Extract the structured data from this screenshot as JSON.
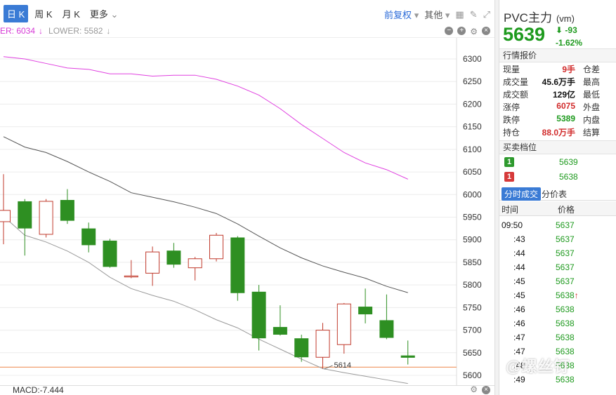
{
  "toolbar": {
    "periods": [
      "日 K",
      "周 K",
      "月 K",
      "更多"
    ],
    "more_arrow": "⌄",
    "fuquan": "前复权",
    "other": "其他",
    "caret": "▾"
  },
  "indicator": {
    "upper": "ER: 6034",
    "upper_arrow": "↓",
    "lower": "LOWER: 5582",
    "lower_arrow": "↓"
  },
  "macd": {
    "label": "MACD:-7.444"
  },
  "quote": {
    "symbol": "PVC主力",
    "code": "(vm)",
    "price": "5639",
    "change": "-93",
    "change_arrow": "⬇",
    "change_pct": "-1.62%"
  },
  "sections": {
    "quote_title": "行情报价",
    "orderbook_title": "买卖档位"
  },
  "quote_rows": [
    {
      "k": "现量",
      "v": "9手",
      "color": "#d12b2b",
      "k2": "仓差"
    },
    {
      "k": "成交量",
      "v": "45.6万手",
      "color": "#111111",
      "k2": "最高"
    },
    {
      "k": "成交额",
      "v": "129亿",
      "color": "#111111",
      "k2": "最低"
    },
    {
      "k": "涨停",
      "v": "6075",
      "color": "#d12b2b",
      "k2": "外盘"
    },
    {
      "k": "跌停",
      "v": "5389",
      "color": "#1e9a1e",
      "k2": "内盘"
    },
    {
      "k": "持仓",
      "v": "88.0万手",
      "color": "#d12b2b",
      "k2": "结算"
    }
  ],
  "orderbook": [
    {
      "badge": "1",
      "side": "g",
      "price": "5639"
    },
    {
      "badge": "1",
      "side": "r",
      "price": "5638"
    }
  ],
  "tabs": {
    "active": "分时成交",
    "other": "分价表"
  },
  "ticks_header": {
    "time": "时间",
    "price": "价格"
  },
  "ticks": [
    {
      "t": "09:50",
      "p": "5637"
    },
    {
      "t": ":43",
      "p": "5637"
    },
    {
      "t": ":44",
      "p": "5637"
    },
    {
      "t": ":44",
      "p": "5637"
    },
    {
      "t": ":45",
      "p": "5637"
    },
    {
      "t": ":45",
      "p": "5638",
      "up": "↑"
    },
    {
      "t": ":46",
      "p": "5638"
    },
    {
      "t": ":46",
      "p": "5638"
    },
    {
      "t": ":47",
      "p": "5638"
    },
    {
      "t": ":47",
      "p": "5638"
    },
    {
      "t": ":48",
      "p": "5638"
    },
    {
      "t": ":49",
      "p": "5638"
    }
  ],
  "watermark": "@螺丝钉",
  "chart_data": {
    "type": "candlestick",
    "y_ticks": [
      6300,
      6250,
      6200,
      6150,
      6100,
      6050,
      6000,
      5950,
      5900,
      5850,
      5800,
      5750,
      5700,
      5650,
      5600
    ],
    "ylim": [
      5590,
      6310
    ],
    "candles": [
      {
        "o": 5940,
        "c": 5965,
        "h": 6045,
        "l": 5890
      },
      {
        "o": 5985,
        "c": 5925,
        "h": 5990,
        "l": 5865
      },
      {
        "o": 5912,
        "c": 5985,
        "h": 5990,
        "l": 5905
      },
      {
        "o": 5988,
        "c": 5942,
        "h": 6012,
        "l": 5935
      },
      {
        "o": 5925,
        "c": 5888,
        "h": 5938,
        "l": 5872
      },
      {
        "o": 5898,
        "c": 5840,
        "h": 5902,
        "l": 5838
      },
      {
        "o": 5818,
        "c": 5820,
        "h": 5855,
        "l": 5815
      },
      {
        "o": 5826,
        "c": 5873,
        "h": 5885,
        "l": 5798
      },
      {
        "o": 5876,
        "c": 5845,
        "h": 5893,
        "l": 5838
      },
      {
        "o": 5838,
        "c": 5858,
        "h": 5862,
        "l": 5810
      },
      {
        "o": 5858,
        "c": 5910,
        "h": 5915,
        "l": 5852
      },
      {
        "o": 5905,
        "c": 5782,
        "h": 5908,
        "l": 5765
      },
      {
        "o": 5785,
        "c": 5682,
        "h": 5800,
        "l": 5655
      },
      {
        "o": 5707,
        "c": 5690,
        "h": 5755,
        "l": 5688
      },
      {
        "o": 5682,
        "c": 5640,
        "h": 5690,
        "l": 5630
      },
      {
        "o": 5640,
        "c": 5700,
        "h": 5716,
        "l": 5615
      },
      {
        "o": 5668,
        "c": 5758,
        "h": 5760,
        "l": 5648
      },
      {
        "o": 5752,
        "c": 5735,
        "h": 5792,
        "l": 5715
      },
      {
        "o": 5722,
        "c": 5683,
        "h": 5779,
        "l": 5680
      },
      {
        "o": 5644,
        "c": 5639,
        "h": 5677,
        "l": 5624
      }
    ],
    "upper_band": [
      6305,
      6300,
      6290,
      6280,
      6277,
      6267,
      6267,
      6262,
      6264,
      6264,
      6255,
      6240,
      6220,
      6190,
      6155,
      6124,
      6093,
      6070,
      6055,
      6034
    ],
    "mid_band": [
      6128,
      6105,
      6093,
      6073,
      6050,
      6029,
      6004,
      5994,
      5984,
      5972,
      5958,
      5935,
      5908,
      5882,
      5860,
      5842,
      5828,
      5815,
      5797,
      5783
    ],
    "lower_band": [
      5952,
      5910,
      5895,
      5875,
      5850,
      5817,
      5792,
      5777,
      5764,
      5745,
      5723,
      5705,
      5680,
      5658,
      5636,
      5615,
      5606,
      5598,
      5590,
      5582
    ],
    "price_line": 5618,
    "low_marker": {
      "value": 5614,
      "label": "5614"
    },
    "legend_entries": [
      "UPPER",
      "LOWER"
    ]
  }
}
